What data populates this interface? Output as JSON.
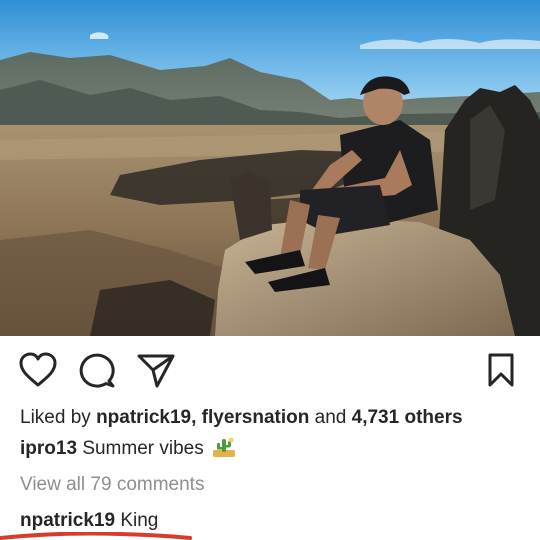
{
  "post": {
    "photo": {
      "alt_icon": "mountain-photo"
    },
    "actions": {
      "like_icon": "heart-icon",
      "comment_icon": "comment-bubble-icon",
      "share_icon": "paper-plane-icon",
      "save_icon": "bookmark-icon"
    },
    "likes": {
      "prefix": "Liked by",
      "user1": "npatrick19",
      "separator": ",",
      "user2": "flyersnation",
      "and_text": "and",
      "others_count": "4,731 others"
    },
    "caption": {
      "username": "ipro13",
      "text": "Summer vibes",
      "emoji": "cactus-desert-emoji"
    },
    "view_all_comments": "View all 79 comments",
    "comments": [
      {
        "username": "npatrick19",
        "text": "King"
      }
    ],
    "colors": {
      "text": "#262626",
      "muted": "#8e8e8e",
      "underline_mark": "#d93b2b"
    }
  }
}
